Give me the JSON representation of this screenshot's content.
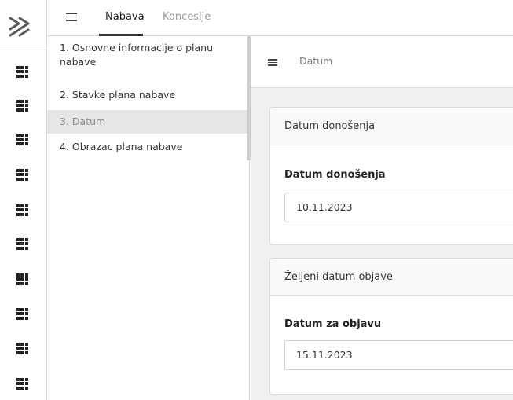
{
  "topbar": {
    "tabs": [
      {
        "label": "Nabava"
      },
      {
        "label": "Koncesije"
      }
    ]
  },
  "nav": {
    "items": [
      {
        "label": "1. Osnovne informacije o planu nabave"
      },
      {
        "label": "2. Stavke plana nabave"
      },
      {
        "label": "3. Datum"
      },
      {
        "label": "4. Obrazac plana nabave"
      }
    ]
  },
  "main": {
    "title": "Datum",
    "cards": [
      {
        "heading": "Datum donošenja",
        "field_label": "Datum donošenja",
        "value": "10.11.2023"
      },
      {
        "heading": "Željeni datum objave",
        "field_label": "Datum za objavu",
        "value": "15.11.2023"
      }
    ]
  },
  "icons": {
    "logo": "chevrons-right-icon",
    "rail_items": "grid-icon"
  },
  "colors": {
    "active_nav_bg": "#e6e6e6",
    "main_bg": "#f0f0f0",
    "border": "#d8d8d8"
  }
}
